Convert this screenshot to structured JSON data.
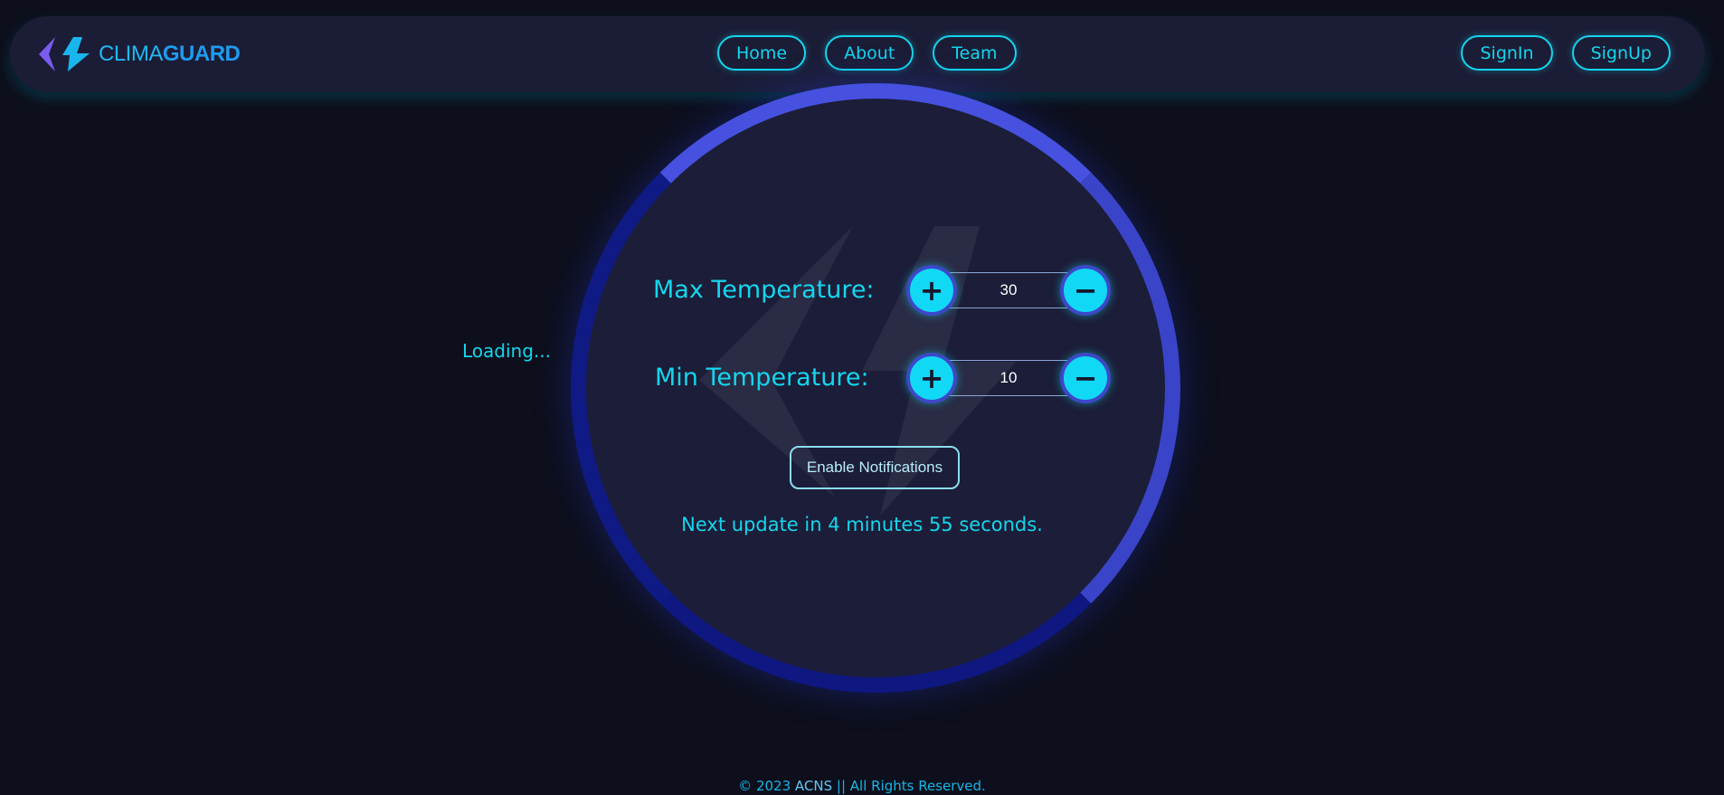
{
  "app": {
    "logo_light": "CLIMA",
    "logo_bold": "GUARD",
    "logo_icon": "chevrons-logo-icon"
  },
  "nav": {
    "center": [
      {
        "label": "Home"
      },
      {
        "label": "About"
      },
      {
        "label": "Team"
      }
    ],
    "right": [
      {
        "label": "SignIn"
      },
      {
        "label": "SignUp"
      }
    ]
  },
  "status": {
    "loading": "Loading..."
  },
  "thermostat": {
    "max": {
      "label": "Max Temperature:",
      "value": "30",
      "plus_icon": "plus-icon",
      "minus_icon": "minus-icon"
    },
    "min": {
      "label": "Min Temperature:",
      "value": "10",
      "plus_icon": "plus-icon",
      "minus_icon": "minus-icon"
    },
    "notify_button": "Enable Notifications",
    "next_update": "Next update in 4 minutes 55 seconds."
  },
  "footer": {
    "prefix": "© 2023 ",
    "brand": "ACNS",
    "suffix": " || All Rights Reserved."
  },
  "colors": {
    "background": "#0d0f1c",
    "panel": "#1c1d38",
    "accent": "#14d6ee",
    "ring": "#3a44cc"
  }
}
